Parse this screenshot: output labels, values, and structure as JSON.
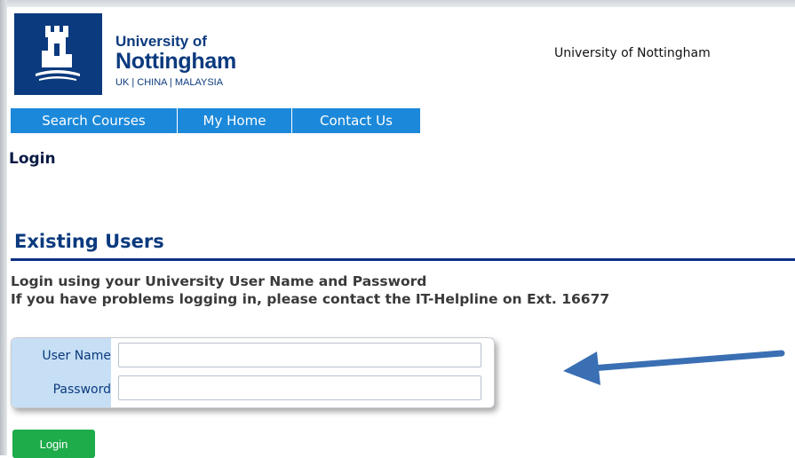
{
  "header": {
    "logo": {
      "line1": "University of",
      "line2": "Nottingham",
      "line3": "UK | CHINA | MALAYSIA"
    },
    "title": "University of Nottingham"
  },
  "nav": {
    "items": [
      {
        "label": "Search Courses"
      },
      {
        "label": "My Home"
      },
      {
        "label": "Contact Us"
      }
    ]
  },
  "page": {
    "heading": "Login"
  },
  "existing_users": {
    "heading": "Existing Users",
    "info_line1": "Login using your University User Name and Password",
    "info_line2": "If you have problems logging in, please contact the IT-Helpline on Ext. 16677"
  },
  "form": {
    "username_label": "User Name",
    "username_value": "",
    "password_label": "Password",
    "password_value": "",
    "login_label": "Login"
  },
  "colors": {
    "brand_navy": "#0b3a7e",
    "nav_blue": "#1b88da",
    "login_green": "#1eab4a",
    "arrow_blue": "#3a6fb3"
  },
  "icons": {
    "logo": "castle-tower-icon",
    "annotation": "arrow-left-icon"
  }
}
